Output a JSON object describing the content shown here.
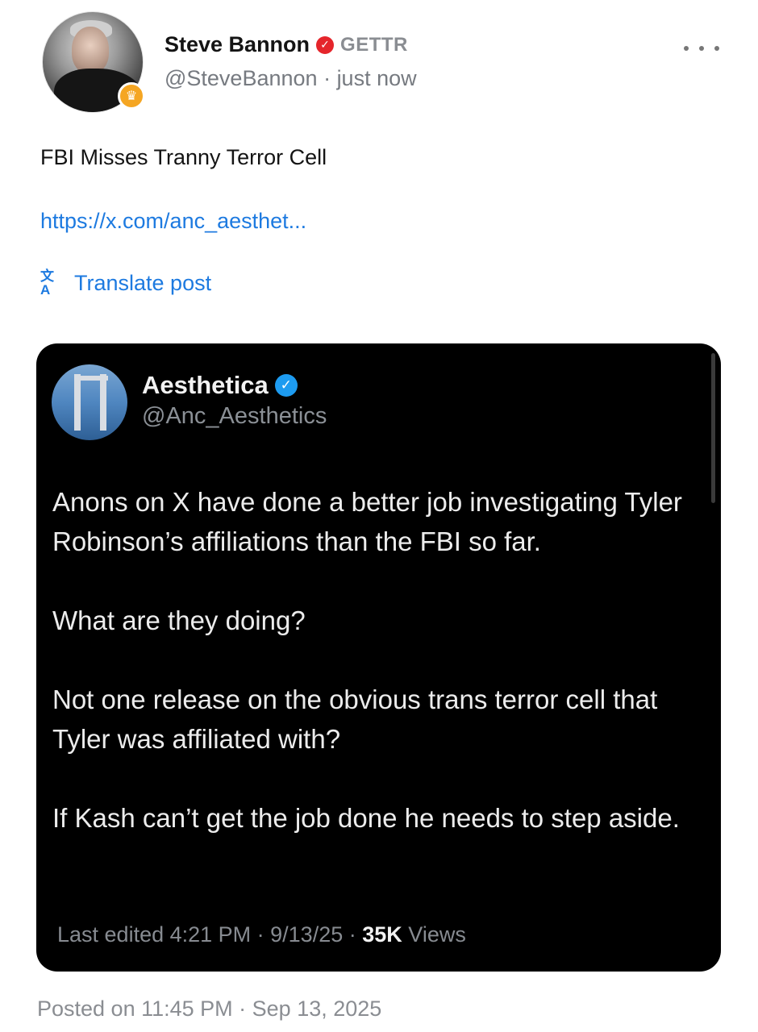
{
  "post": {
    "author_name": "Steve Bannon",
    "platform_label": "GETTR",
    "handle": "@SteveBannon",
    "time": "just now",
    "text": "FBI Misses Tranny Terror Cell",
    "link": "https://x.com/anc_aesthet...",
    "translate_label": "Translate post",
    "posted_on": "Posted on 11:45 PM · Sep 13, 2025"
  },
  "quoted": {
    "author_name": "Aesthetica",
    "handle": "@Anc_Aesthetics",
    "paragraphs": [
      "Anons on X have done a better job investigating Tyler Robinson’s affiliations than the FBI so far.",
      "What are they doing?",
      "Not one release on the obvious trans terror cell that Tyler was affiliated with?",
      "If Kash can’t get the job done he needs to step aside."
    ],
    "edited": "Last edited 4:21 PM · 9/13/25",
    "views_count": "35K",
    "views_label": "Views"
  },
  "colors": {
    "link": "#1d7ae0",
    "verified_red": "#e5252b",
    "verified_blue": "#1d9bf0",
    "card_bg": "#000000"
  },
  "icons": {
    "avatar_badge": "crown-icon",
    "author_verified": "verified-check-icon",
    "more": "more-dots-icon",
    "translate": "translate-icon"
  }
}
